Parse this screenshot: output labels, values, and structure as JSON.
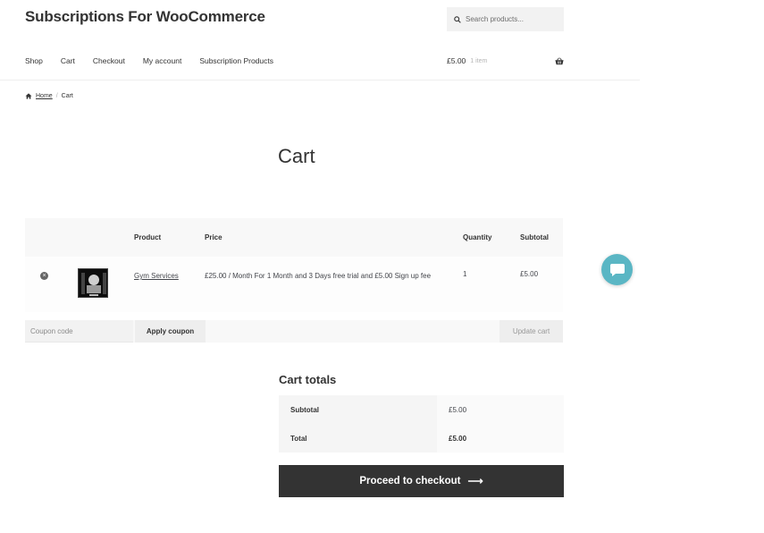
{
  "site": {
    "title": "Subscriptions For WooCommerce"
  },
  "search": {
    "placeholder": "Search products..."
  },
  "nav": {
    "items": [
      "Shop",
      "Cart",
      "Checkout",
      "My account",
      "Subscription Products"
    ]
  },
  "minicart": {
    "amount": "£5.00",
    "count": "1 item"
  },
  "breadcrumb": {
    "home": "Home",
    "separator": "/",
    "current": "Cart"
  },
  "page": {
    "title": "Cart"
  },
  "cart": {
    "headers": {
      "product": "Product",
      "price": "Price",
      "quantity": "Quantity",
      "subtotal": "Subtotal"
    },
    "items": [
      {
        "name": "Gym Services",
        "price": "£25.00 / Month For 1 Month and 3 Days free trial and £5.00 Sign up fee",
        "quantity": "1",
        "subtotal": "£5.00"
      }
    ],
    "remove_symbol": "×",
    "coupon_placeholder": "Coupon code",
    "apply_label": "Apply coupon",
    "update_label": "Update cart"
  },
  "totals": {
    "title": "Cart totals",
    "subtotal_label": "Subtotal",
    "subtotal_value": "£5.00",
    "total_label": "Total",
    "total_value": "£5.00"
  },
  "checkout": {
    "label": "Proceed to checkout",
    "arrow": "⟶"
  },
  "colors": {
    "accent_dark": "#333333",
    "chat_bubble": "#5ab6c4"
  },
  "icons": {
    "search": "search-icon",
    "basket": "basket-icon",
    "home": "home-icon",
    "chat": "chat-icon"
  }
}
